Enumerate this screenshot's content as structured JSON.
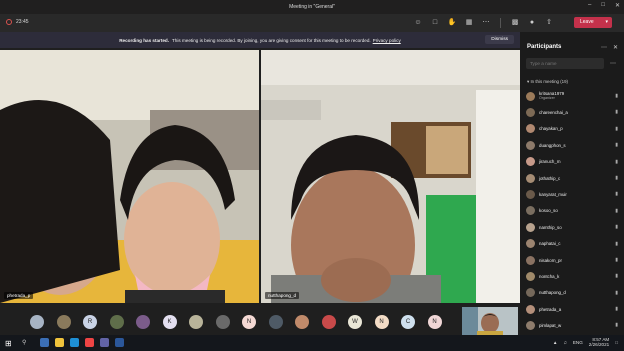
{
  "window": {
    "title": "Meeting in \"General\""
  },
  "toolbar": {
    "recording_time": "23:45",
    "leave_label": "Leave"
  },
  "banner": {
    "title": "Recording has started.",
    "text": "This meeting is being recorded. By joining, you are giving consent for this meeting to be recorded.",
    "link": "Privacy policy",
    "dismiss": "Dismiss"
  },
  "videos": [
    {
      "name": "phetrada_p"
    },
    {
      "name": "nutthapong_d"
    }
  ],
  "gallery": {
    "thumbs": [
      {
        "letter": "",
        "color": "#a7b4c4"
      },
      {
        "letter": "",
        "color": "#8a7a5c"
      },
      {
        "letter": "R",
        "color": "#c9d3e6"
      },
      {
        "letter": "",
        "color": "#5f6e4a"
      },
      {
        "letter": "",
        "color": "#7b5c8a"
      },
      {
        "letter": "K",
        "color": "#e3dff0"
      },
      {
        "letter": "",
        "color": "#b9b49a"
      },
      {
        "letter": "",
        "color": "#6a6a6a"
      },
      {
        "letter": "N",
        "color": "#f4d9d4"
      },
      {
        "letter": "",
        "color": "#4e5a66"
      },
      {
        "letter": "",
        "color": "#c08a6a"
      },
      {
        "letter": "",
        "color": "#c94a4a"
      },
      {
        "letter": "W",
        "color": "#e9e6d6"
      },
      {
        "letter": "N",
        "color": "#f3dcc6"
      },
      {
        "letter": "C",
        "color": "#cfe0ee"
      },
      {
        "letter": "N",
        "color": "#f0d6d6"
      }
    ]
  },
  "panel": {
    "title": "Participants",
    "search_placeholder": "Type a name",
    "in_meeting": "In this meeting (19)",
    "participants": [
      {
        "name": "kritsana1979",
        "sub": "Organizer",
        "color": "#9c7b5a"
      },
      {
        "name": "chareenchai_a",
        "sub": "",
        "color": "#7d6a55"
      },
      {
        "name": "chayakan_p",
        "sub": "",
        "color": "#b08870"
      },
      {
        "name": "duangphon_s",
        "sub": "",
        "color": "#8d7a6a"
      },
      {
        "name": "jiranuch_m",
        "sub": "",
        "color": "#c79a8a"
      },
      {
        "name": "jothathip_c",
        "sub": "",
        "color": "#a58c74"
      },
      {
        "name": "kanyarat_muir",
        "sub": "",
        "color": "#6a5a4a"
      },
      {
        "name": "kosoo_so",
        "sub": "",
        "color": "#7a6e60"
      },
      {
        "name": "namthip_so",
        "sub": "",
        "color": "#b7a28e"
      },
      {
        "name": "naphatai_c",
        "sub": "",
        "color": "#9c8470"
      },
      {
        "name": "nisakorn_pr",
        "sub": "",
        "color": "#8a7262"
      },
      {
        "name": "nontcha_k",
        "sub": "",
        "color": "#a08a6a"
      },
      {
        "name": "nutthapong_d",
        "sub": "",
        "color": "#75685a"
      },
      {
        "name": "phetrada_a",
        "sub": "",
        "color": "#b48f7a"
      },
      {
        "name": "pimlapat_w",
        "sub": "",
        "color": "#8e7c6c"
      }
    ]
  },
  "taskbar": {
    "time": "8:57 AM",
    "date": "2/26/2021",
    "lang": "ENG"
  }
}
